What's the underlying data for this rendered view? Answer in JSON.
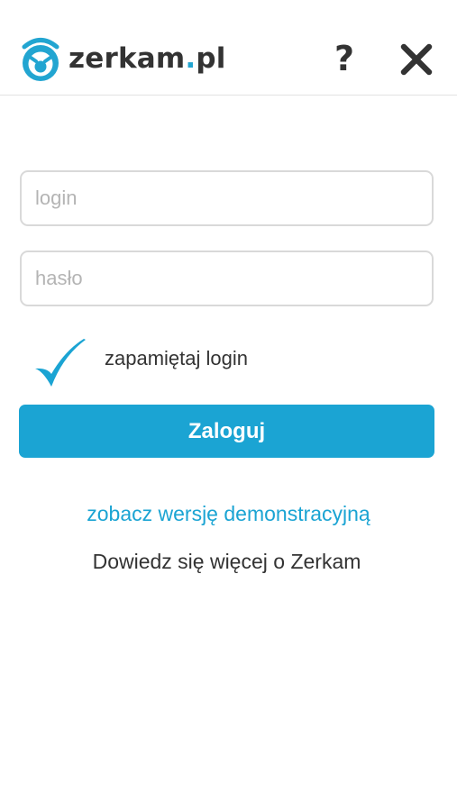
{
  "header": {
    "logo_name": "zerkam",
    "logo_dot": ".",
    "logo_tld": "pl",
    "help_label": "?",
    "close_icon": "close-icon",
    "logo_icon": "owl-eye-logo-icon"
  },
  "form": {
    "login_placeholder": "login",
    "login_value": "",
    "password_placeholder": "hasło",
    "password_value": "",
    "remember_label": "zapamiętaj login",
    "remember_checked": true,
    "submit_label": "Zaloguj"
  },
  "links": {
    "demo": "zobacz wersję demonstracyjną",
    "more": "Dowiedz się więcej o Zerkam"
  },
  "colors": {
    "accent": "#1ba4d3",
    "text": "#333333",
    "placeholder": "#b4b4b4",
    "border": "#d9d9d9"
  }
}
